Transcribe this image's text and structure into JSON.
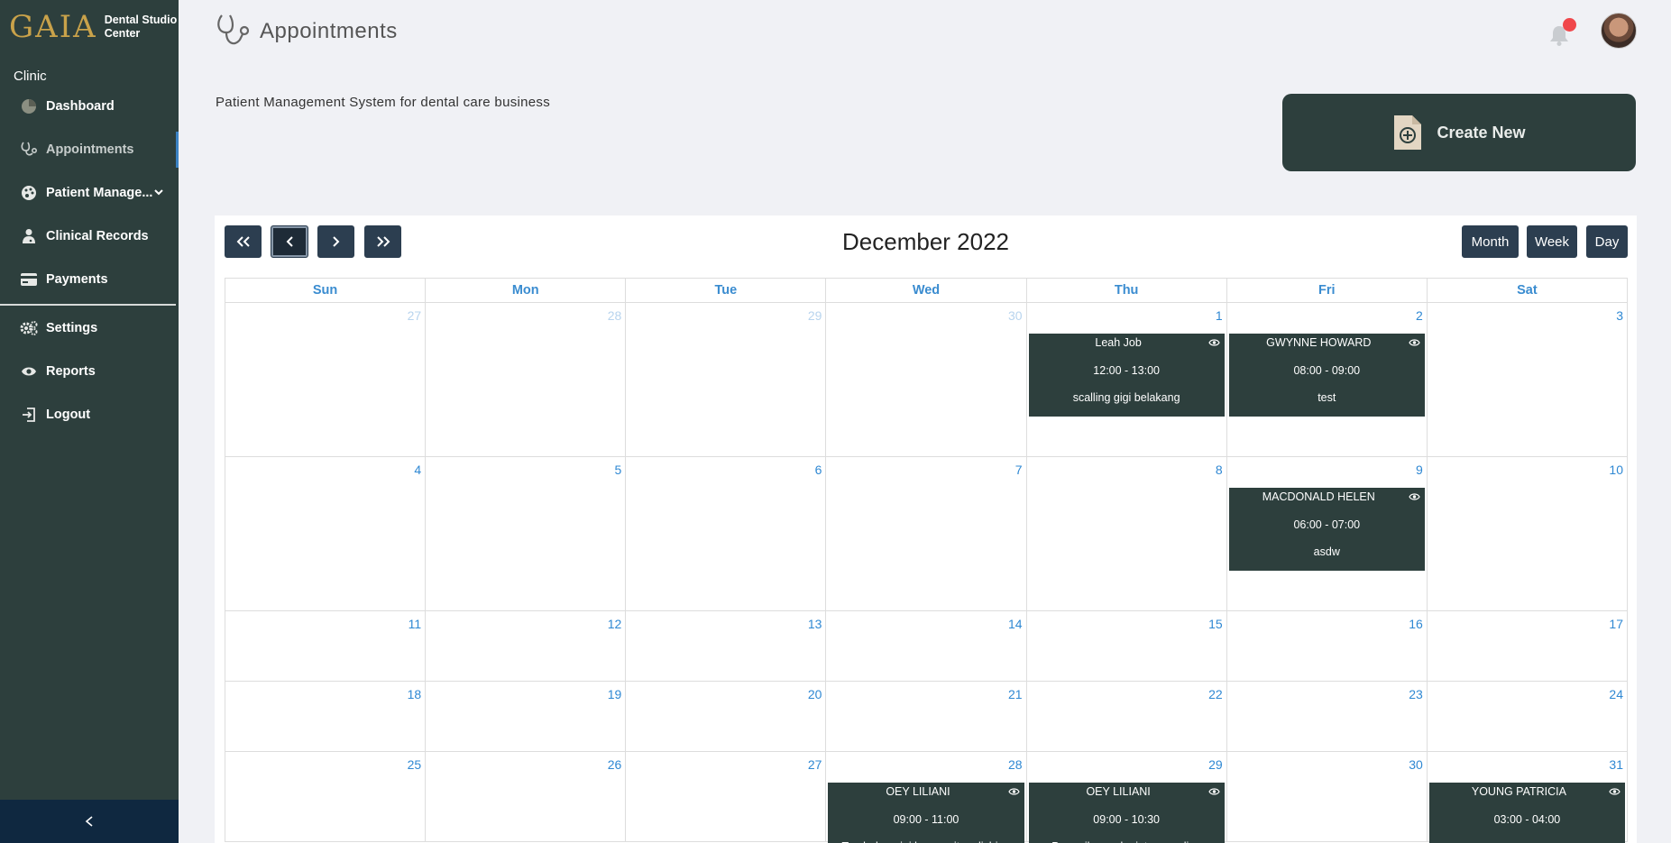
{
  "brand": {
    "logo": "GAIA",
    "name_line1": "Dental Studio",
    "name_line2": "Center"
  },
  "sidebar": {
    "section": "Clinic",
    "items": [
      {
        "label": "Dashboard",
        "icon": "pie-chart-icon"
      },
      {
        "label": "Appointments",
        "icon": "stethoscope-icon"
      },
      {
        "label": "Patient Manage...",
        "icon": "palette-icon"
      },
      {
        "label": "Clinical Records",
        "icon": "doctor-icon"
      },
      {
        "label": "Payments",
        "icon": "credit-card-icon"
      },
      {
        "label": "Settings",
        "icon": "gears-icon"
      },
      {
        "label": "Reports",
        "icon": "eye-icon"
      },
      {
        "label": "Logout",
        "icon": "logout-icon"
      }
    ],
    "active": "Appointments"
  },
  "header": {
    "title": "Appointments"
  },
  "tagline": "Patient Management System for dental care business",
  "create_button": {
    "label": "Create New"
  },
  "calendar": {
    "title": "December 2022",
    "views": [
      "Month",
      "Week",
      "Day"
    ],
    "weekdays": [
      "Sun",
      "Mon",
      "Tue",
      "Wed",
      "Thu",
      "Fri",
      "Sat"
    ],
    "weeks": [
      [
        {
          "day": "27",
          "other": true
        },
        {
          "day": "28",
          "other": true
        },
        {
          "day": "29",
          "other": true
        },
        {
          "day": "30",
          "other": true
        },
        {
          "day": "1",
          "event": {
            "name": "Leah Job",
            "time": "12:00 - 13:00",
            "desc": "scalling gigi belakang"
          }
        },
        {
          "day": "2",
          "event": {
            "name": "GWYNNE HOWARD",
            "time": "08:00 - 09:00",
            "desc": "test"
          }
        },
        {
          "day": "3"
        }
      ],
      [
        {
          "day": "4"
        },
        {
          "day": "5"
        },
        {
          "day": "6"
        },
        {
          "day": "7"
        },
        {
          "day": "8"
        },
        {
          "day": "9",
          "event": {
            "name": "MACDONALD HELEN",
            "time": "06:00 - 07:00",
            "desc": "asdw"
          }
        },
        {
          "day": "10"
        }
      ],
      [
        {
          "day": "11"
        },
        {
          "day": "12"
        },
        {
          "day": "13"
        },
        {
          "day": "14"
        },
        {
          "day": "15"
        },
        {
          "day": "16"
        },
        {
          "day": "17"
        }
      ],
      [
        {
          "day": "18"
        },
        {
          "day": "19"
        },
        {
          "day": "20"
        },
        {
          "day": "21"
        },
        {
          "day": "22"
        },
        {
          "day": "23"
        },
        {
          "day": "24"
        }
      ],
      [
        {
          "day": "25"
        },
        {
          "day": "26"
        },
        {
          "day": "27"
        },
        {
          "day": "28",
          "event": {
            "name": "OEY LILIANI",
            "time": "09:00 - 11:00",
            "desc": "Tambalan gigi komposit, polishing"
          }
        },
        {
          "day": "29",
          "event": {
            "name": "OEY LILIANI",
            "time": "09:00 - 10:30",
            "desc": "Pemeriksaan lanjutan, scaling"
          }
        },
        {
          "day": "30"
        },
        {
          "day": "31",
          "event": {
            "name": "YOUNG PATRICIA",
            "time": "03:00 - 04:00",
            "desc": ""
          }
        }
      ]
    ]
  },
  "colors": {
    "sidebar": "#2d3f3d",
    "accent": "#3a8cd0",
    "event": "#2d3f3d",
    "button": "#2c3e50",
    "notification": "#f0474b"
  }
}
